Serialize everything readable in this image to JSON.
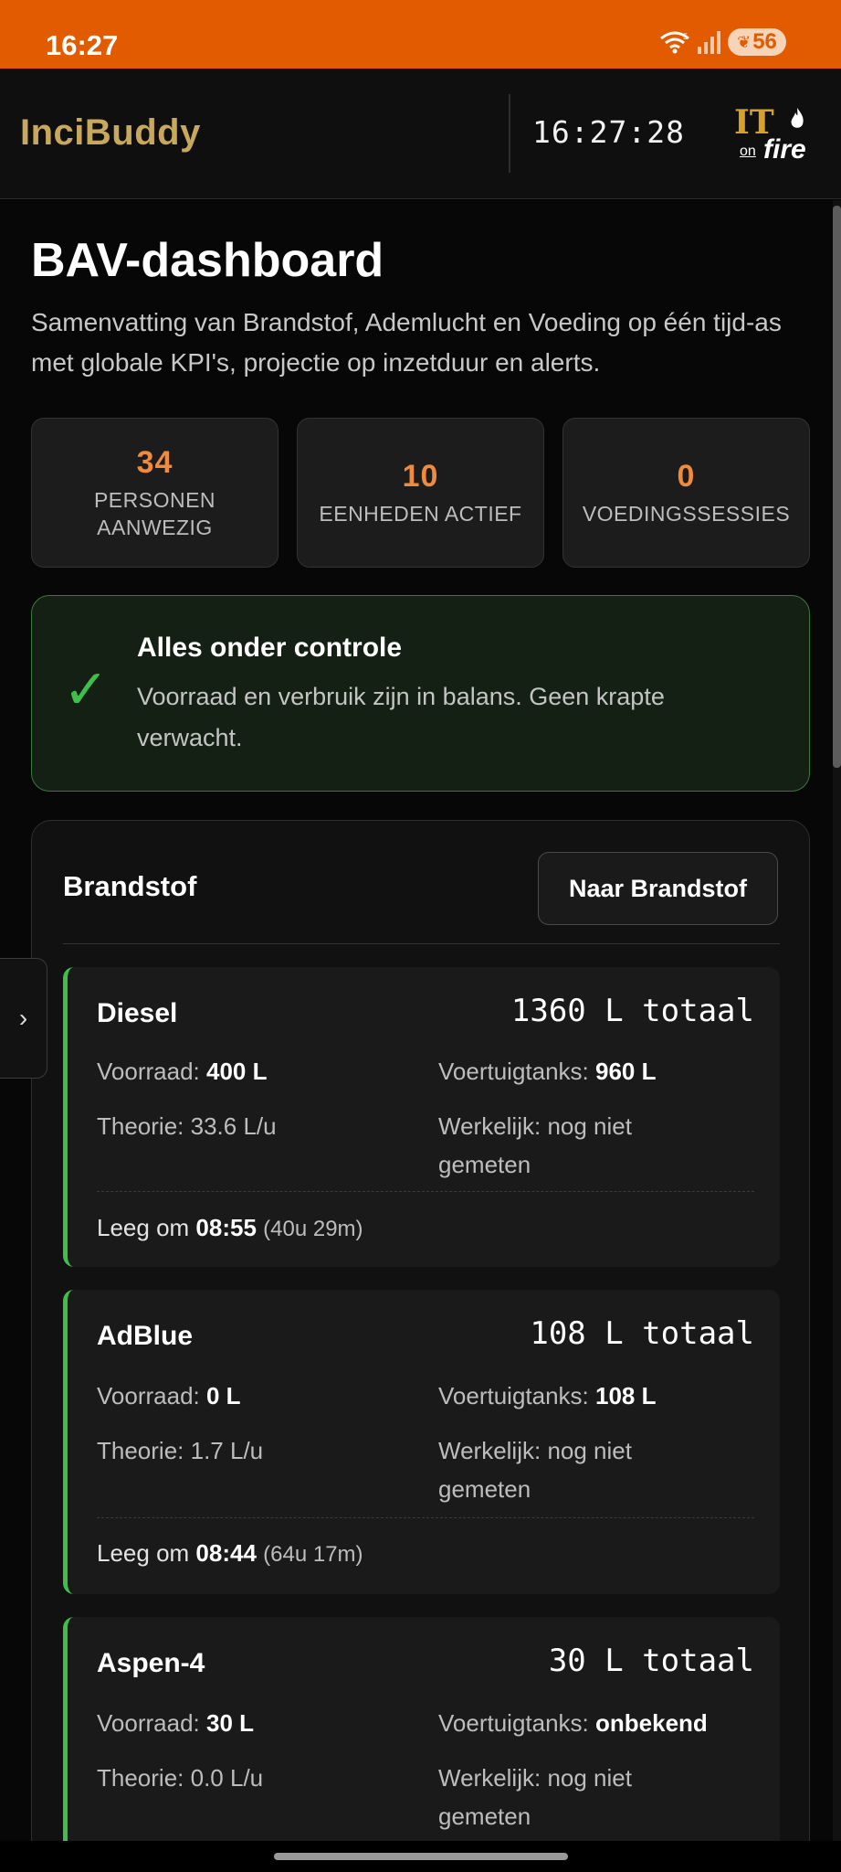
{
  "statusbar": {
    "time": "16:27",
    "battery": "56"
  },
  "header": {
    "brand": "InciBuddy",
    "clock": "16:27:28",
    "logo_it": "IT",
    "logo_on": "on",
    "logo_fire": "fire"
  },
  "page": {
    "title": "BAV-dashboard",
    "description": "Samenvatting van Brandstof, Ademlucht en Voeding op één tijd-as met globale KPI's, projectie op inzetduur en alerts."
  },
  "kpis": [
    {
      "value": "34",
      "label": "PERSONEN AANWEZIG"
    },
    {
      "value": "10",
      "label": "EENHEDEN ACTIEF"
    },
    {
      "value": "0",
      "label": "VOEDINGSSESSIES"
    }
  ],
  "alert": {
    "title": "Alles onder controle",
    "text": "Voorraad en verbruik zijn in balans. Geen krapte verwacht."
  },
  "card": {
    "title": "Brandstof",
    "button": "Naar Brandstof",
    "labels": {
      "stock": "Voorraad:",
      "tanks": "Voertuigtanks:",
      "theory": "Theorie:",
      "actual": "Werkelijk:",
      "empty": "Leeg om"
    },
    "items": [
      {
        "name": "Diesel",
        "total": "1360 L totaal",
        "stock": "400 L",
        "tanks": "960 L",
        "theory": "33.6 L/u",
        "actual": "nog niet gemeten",
        "empty_at": "08:55",
        "empty_in": "(40u 29m)"
      },
      {
        "name": "AdBlue",
        "total": "108 L totaal",
        "stock": "0 L",
        "tanks": "108 L",
        "theory": "1.7 L/u",
        "actual": "nog niet gemeten",
        "empty_at": "08:44",
        "empty_in": "(64u 17m)"
      },
      {
        "name": "Aspen-4",
        "total": "30 L totaal",
        "stock": "30 L",
        "tanks": "onbekend",
        "theory": "0.0 L/u",
        "actual": "nog niet gemeten"
      }
    ]
  },
  "colors": {
    "accent": "#f08a3c",
    "brand": "#c8a85c",
    "ok": "#3fbf4a",
    "statusbar": "#e25b00"
  }
}
